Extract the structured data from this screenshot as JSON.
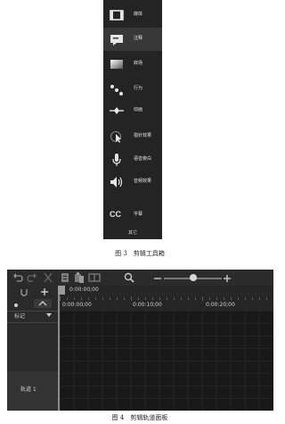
{
  "toolbox": {
    "items": [
      {
        "label": "媒体",
        "icon": "media-icon"
      },
      {
        "label": "注释",
        "icon": "annotation-icon"
      },
      {
        "label": "转场",
        "icon": "transition-icon"
      },
      {
        "label": "行为",
        "icon": "behavior-icon"
      },
      {
        "label": "动画",
        "icon": "animation-icon"
      },
      {
        "label": "指针效果",
        "icon": "cursor-effect-icon"
      },
      {
        "label": "语音旁白",
        "icon": "voice-narration-icon"
      },
      {
        "label": "音频效果",
        "icon": "audio-effect-icon"
      },
      {
        "label": "字幕",
        "icon": "captions-icon",
        "glyph": "CC"
      }
    ],
    "more_label": "其它",
    "caption": "图 3　剪辑工具箱"
  },
  "timeline": {
    "toolbar_icons": [
      "undo-icon",
      "redo-icon",
      "cut-icon",
      "copy-icon",
      "paste-icon",
      "split-icon",
      "zoom-icon",
      "zoom-out-icon",
      "zoom-in-icon"
    ],
    "zoom_level": 0.5,
    "playhead_time": "0:00:00;00",
    "ruler_times": [
      "0:00:00;00",
      "0:00:10;00",
      "0:00:20;00"
    ],
    "markers_label": "标记",
    "track_label": "轨道 1",
    "caption": "图 4　剪辑轨道面板"
  }
}
